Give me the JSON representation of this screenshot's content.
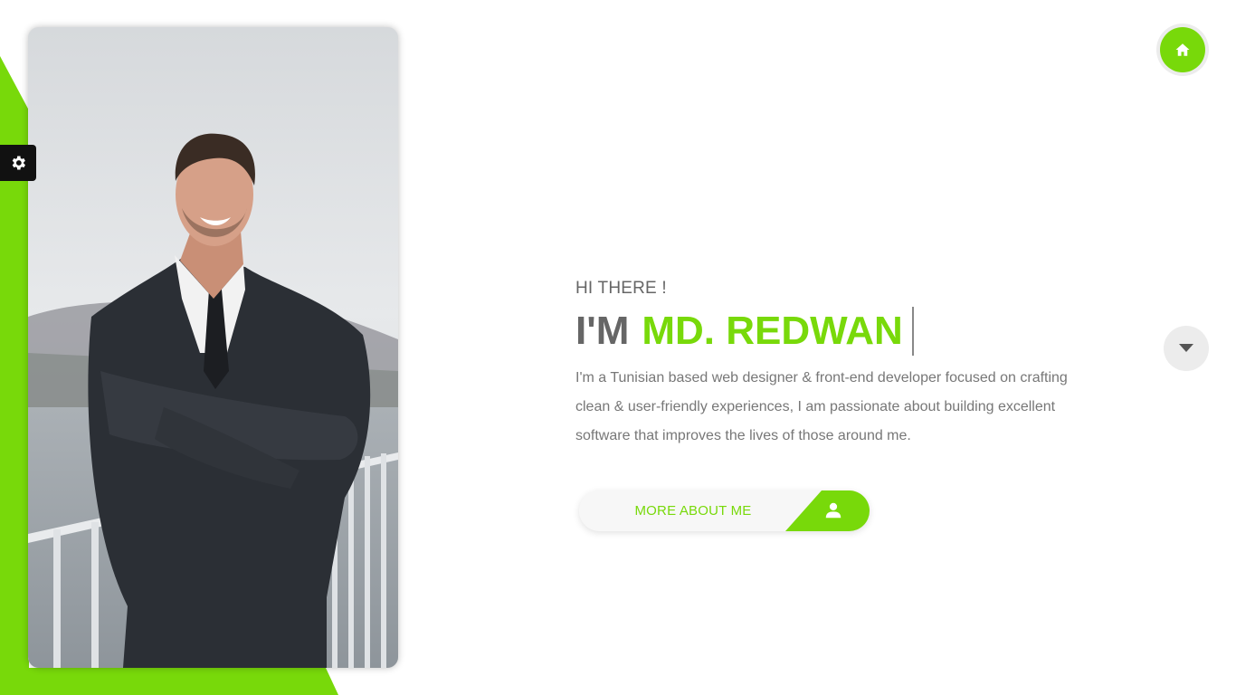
{
  "theme": {
    "accent": "#78d90a",
    "text_dark": "#666666",
    "text_body": "#777777"
  },
  "hero": {
    "greeting": "HI THERE !",
    "title_prefix": "I'M",
    "title_name": "MD. REDWAN",
    "bio": "I'm a Tunisian based web designer & front-end developer focused on crafting clean & user-friendly experiences, I am passionate about building excellent software that improves the lives of those around me."
  },
  "cta": {
    "label": "MORE ABOUT ME",
    "icon": "user-icon"
  },
  "nav": {
    "home_icon": "home-icon",
    "scroll_icon": "caret-down-icon",
    "settings_icon": "gear-icon"
  },
  "photo": {
    "subject": "portrait-photo"
  }
}
